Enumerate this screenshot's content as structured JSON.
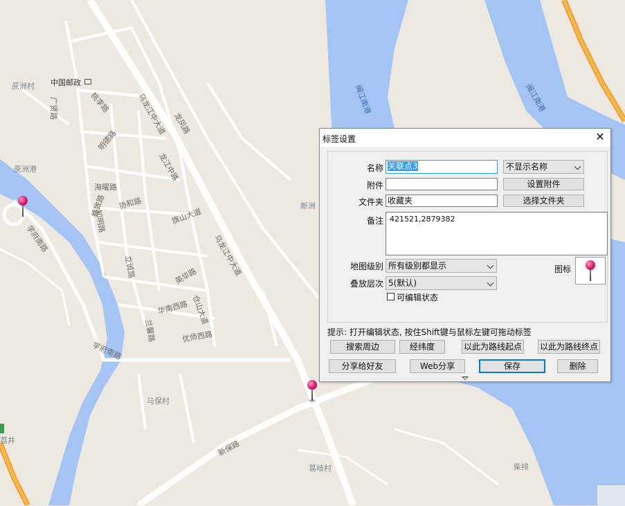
{
  "map": {
    "roads": {
      "wulongjiang_1": "乌龙江中大道",
      "wulongjiang_2": "乌龙江中大道",
      "longfeng": "龙凤路",
      "longjiang_zhong": "龙江中路",
      "xuefu_nan_1": "学府南路",
      "xuefu_nan_2": "学府南路",
      "guangxian": "广贤路",
      "taoli": "桃李路",
      "mingde": "明德路",
      "haiyao": "海曜路",
      "xiehe": "协和路",
      "zhiming": "知明路",
      "gewei": "格致路",
      "qishan": "旗山大道",
      "lixing": "立诚路",
      "yinghua": "英华路",
      "cangshan": "仓山大道",
      "huanan_xi": "华南西路",
      "lanxin": "兰馨路",
      "youshi_xi": "优师西路",
      "xinbao": "新保路"
    },
    "places": {
      "zhouzhou_cun": "蔗洲村",
      "zhouzhou_gang": "蔗洲港",
      "china_post": "中国邮政",
      "xinzhou": "新洲",
      "mabao_cun": "马保村",
      "geqi_cun": "葛岐村",
      "chaipai": "柴排",
      "lijing": "荔井",
      "mabao_2": "马保村"
    },
    "water_labels": {
      "minjiang_1": "闽江南港",
      "minjiang_2": "闽江南港"
    },
    "colors": {
      "land": "#ede9e1",
      "water": "#a4c4f4",
      "road": "#ffffff",
      "highway": "#f5a623"
    }
  },
  "dialog": {
    "title": "标签设置",
    "close_icon": "close-icon",
    "name_label": "名称",
    "name_value": "关联点3",
    "name_display_select": "不显示名称",
    "attachment_label": "附件",
    "attachment_value": "",
    "set_attachment_button": "设置附件",
    "folder_label": "文件夹",
    "folder_value": "收藏夹",
    "choose_folder_button": "选择文件夹",
    "notes_label": "备注",
    "notes_value": "421521,2879382",
    "map_level_label": "地图级别",
    "map_level_value": "所有级别都显示",
    "layer_label": "叠放层次",
    "layer_value": "5(默认)",
    "icon_label": "图标",
    "editable_label": "可编辑状态",
    "hint": "提示: 打开编辑状态, 按住Shift键与鼠标左键可拖动标签",
    "buttons": {
      "search_nearby": "搜索周边",
      "coordinates": "经纬度",
      "route_start": "以此为路线起点",
      "route_end": "以此为路线终点",
      "share_friend": "分享给好友",
      "web_share": "Web分享",
      "save": "保存",
      "delete": "删除"
    }
  }
}
